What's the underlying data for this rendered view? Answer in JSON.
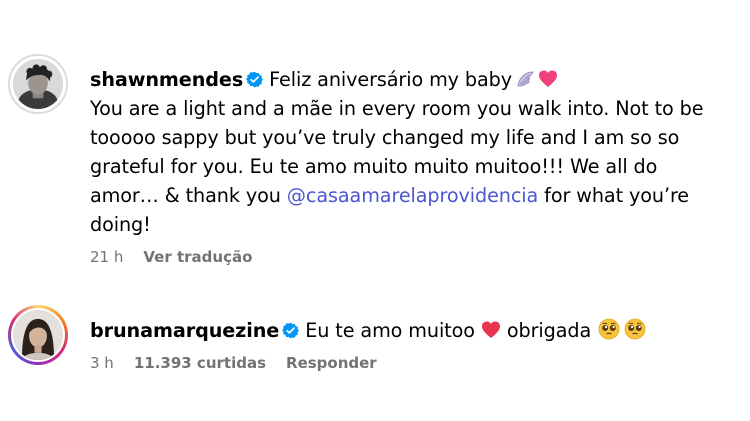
{
  "comments": [
    {
      "username": "shawnmendes",
      "verified": true,
      "avatar": "profile-photo-man-curly-hair",
      "text_before_mention": "Feliz aniversário my baby",
      "text_continued": "You are a light and a mãe in every room you walk into. Not to be tooooo sappy but you’ve truly changed my life and I am so so grateful for you. Eu te amo muito muito muitoo!!! We all do amor… & thank you",
      "mention": "@casaamarelaprovidencia",
      "text_after_mention": "for what you’re doing!",
      "emojis": [
        "wing-emoji",
        "pink-heart-emoji"
      ],
      "time": "21 h",
      "translate_label": "Ver tradução"
    },
    {
      "username": "brunamarquezine",
      "verified": true,
      "avatar": "profile-photo-woman-dark-hair",
      "story_ring": true,
      "text_part1": "Eu te amo muitoo",
      "text_part2": "obrigada",
      "emojis": [
        "red-heart-emoji",
        "pleading-face-emoji",
        "pleading-face-emoji"
      ],
      "time": "3 h",
      "likes": "11.393 curtidas",
      "reply_label": "Responder"
    }
  ],
  "colors": {
    "verified_badge": "#0095f6",
    "mention": "#4b57d1",
    "meta_text": "#737373"
  }
}
